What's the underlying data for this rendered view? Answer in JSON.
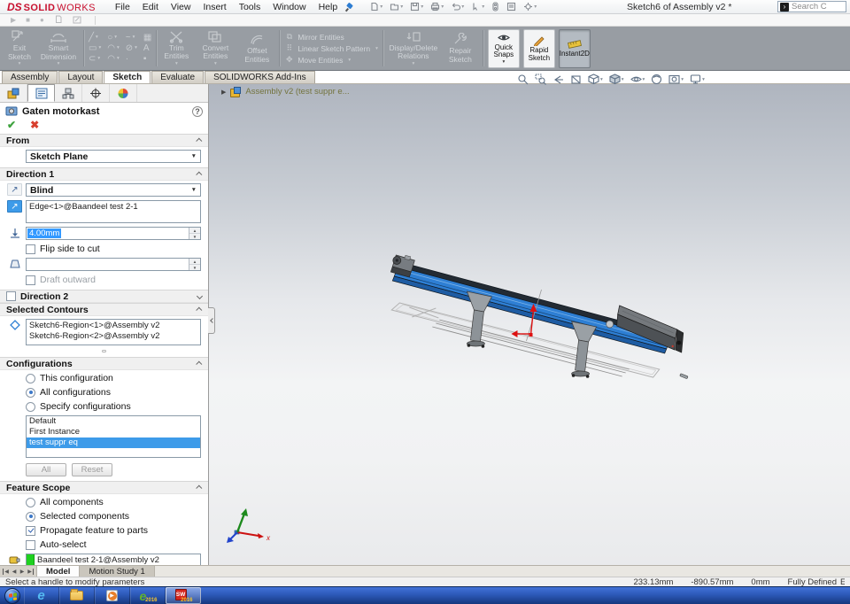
{
  "window": {
    "logo_mark": "DS",
    "logo_solid": "SOLID",
    "logo_works": "WORKS",
    "title": "Sketch6 of Assembly v2 *",
    "search_text": "Search C",
    "menus": [
      "File",
      "Edit",
      "View",
      "Insert",
      "Tools",
      "Window",
      "Help"
    ]
  },
  "ribbon": {
    "tabs": [
      "Assembly",
      "Layout",
      "Sketch",
      "Evaluate",
      "SOLIDWORKS Add-Ins"
    ],
    "active_tab": "Sketch",
    "exit_sketch": "Exit Sketch",
    "smart_dimension": "Smart Dimension",
    "trim_entities": "Trim Entities",
    "convert_entities": "Convert Entities",
    "offset_entities": "Offset Entities",
    "mirror_entities": "Mirror Entities",
    "linear_pattern": "Linear Sketch Pattern",
    "move_entities": "Move Entities",
    "display_delete": "Display/Delete Relations",
    "repair_sketch": "Repair Sketch",
    "quick_snaps": "Quick Snaps",
    "rapid_sketch": "Rapid Sketch",
    "instant2d": "Instant2D"
  },
  "property_manager": {
    "title": "Gaten motorkast",
    "from": {
      "header": "From",
      "plane": "Sketch Plane"
    },
    "direction1": {
      "header": "Direction 1",
      "end_condition": "Blind",
      "edge": "Edge<1>@Baandeel test 2-1",
      "depth": "4.00mm",
      "flip": "Flip side to cut",
      "draft_outward": "Draft outward"
    },
    "direction2": {
      "header": "Direction 2"
    },
    "contours": {
      "header": "Selected Contours",
      "items": [
        "Sketch6-Region<1>@Assembly v2",
        "Sketch6-Region<2>@Assembly v2"
      ]
    },
    "configurations": {
      "header": "Configurations",
      "radios": [
        "This configuration",
        "All configurations",
        "Specify configurations"
      ],
      "selected_radio": "All configurations",
      "list": [
        "Default",
        "First Instance",
        "test suppr eq"
      ],
      "selected_item": "test suppr eq",
      "all_button": "All",
      "reset_button": "Reset"
    },
    "feature_scope": {
      "header": "Feature Scope",
      "radios": [
        "All components",
        "Selected components"
      ],
      "selected_radio": "Selected components",
      "propagate": "Propagate feature to parts",
      "auto_select": "Auto-select",
      "items": [
        "Baandeel test 2-1@Assembly v2"
      ]
    }
  },
  "viewport": {
    "flyout_tree": "Assembly v2 (test suppr e...",
    "triad_x": "x"
  },
  "document_tabs": {
    "model": "Model",
    "motion_study": "Motion Study 1"
  },
  "statusbar": {
    "message": "Select a handle to modify parameters",
    "coord_x": "233.13mm",
    "coord_y": "-890.57mm",
    "coord_z": "0mm",
    "state": "Fully Defined",
    "clipped": "E"
  },
  "taskbar": {
    "sw_label": "SW",
    "sw_year": "2016",
    "launcher_year": "2016"
  },
  "glyphs": {
    "caret": "▾",
    "dropdown": "▼",
    "spin_up": "▲",
    "spin_down": "▼",
    "ok": "✔",
    "cancel": "✖",
    "help": "?",
    "play": "▶",
    "stop": "■",
    "record": "●",
    "flyout": "▶",
    "nav_prev": "◀",
    "nav_next": "▶",
    "reverse_arrow": "↗",
    "pencil": "✎",
    "search_arrow": "›",
    "text_tool": "A"
  },
  "colors": {
    "accent_blue": "#2e7fd4",
    "selection_blue": "#3d9be9",
    "scope_green": "#1fd11f",
    "check_green": "#3fa33f",
    "cancel_red": "#d8402f"
  }
}
